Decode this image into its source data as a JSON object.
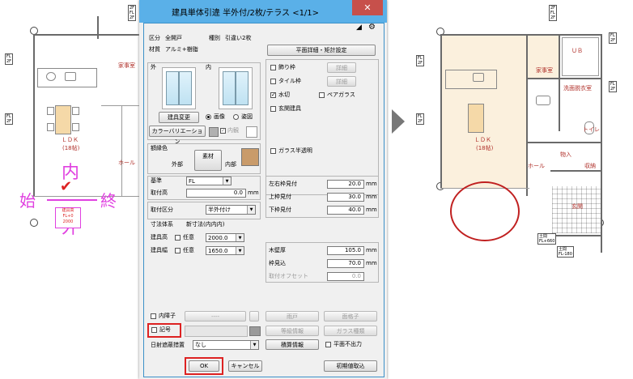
{
  "dialog": {
    "title": "建具単体引違 半外付/2枚/テラス <1/1>",
    "close": "✕",
    "kubun_label": "区分",
    "kubun_value": "全開戸",
    "shubetsu_label": "種別",
    "shubetsu_value": "引違い2枚",
    "zaishitsu_label": "材質",
    "zaishitsu_value": "アルミ+樹脂",
    "heimen_button": "平面詳細・矩計設定",
    "soto_label": "外",
    "uchi_label": "内",
    "tategu_henko": "建具変更",
    "radio_gazo": "画像",
    "radio_sugata": "姿図",
    "color_variation": "カラーバリエーション",
    "naikan": "内観",
    "gakuen_label": "額縁色",
    "sozai_button": "素材",
    "gaibu": "外部",
    "naibu": "内部",
    "kijun_label": "基準",
    "kijun_value": "FL",
    "toritsukedaka_label": "取付高",
    "toritsukedaka_value": "0.0",
    "unit_mm": "mm",
    "toritsuke_kubun_label": "取付区分",
    "toritsuke_kubun_value": "半外付け",
    "sunpo_label": "寸法体系",
    "sunpo_value": "新寸法(内内内)",
    "takasa_label": "建具高",
    "haba_label": "建具幅",
    "nini": "任意",
    "takasa_value": "2000.0",
    "haba_value": "1650.0",
    "right_checks": [
      "飾り枠",
      "タイル枠",
      "水切",
      "玄関建具"
    ],
    "shosai": "詳細",
    "pair_glass": "ペアガラス",
    "glass_semi": "ガラス半透明",
    "dims": [
      {
        "label": "左右枠見付",
        "value": "20.0"
      },
      {
        "label": "上枠見付",
        "value": "30.0"
      },
      {
        "label": "下枠見付",
        "value": "40.0"
      }
    ],
    "kabe_label": "木壁厚",
    "kabe_value": "105.0",
    "wakumi_label": "枠見込",
    "wakumi_value": "70.0",
    "offset_label": "取付オフセット",
    "offset_value": "0.0",
    "naishoji": "内障子",
    "naishoji_field": "----",
    "amado": "雨戸",
    "mengoshi": "面格子",
    "kigo": "記号",
    "kyu_joho": "等級情報",
    "glass_shurui": "ガラス種類",
    "hiyoke_label": "日射遮蔽措置",
    "hiyoke_value": "なし",
    "sekisan": "積算情報",
    "heimen_fushutsu": "平面不出力",
    "ok": "OK",
    "cancel": "キャンセル",
    "shoki": "初期値取込"
  },
  "left_plan": {
    "room_ldk": "ＬＤＫ",
    "room_ldk_size": "(18帖)",
    "room_kaji": "家事室",
    "hall": "ホール",
    "marker_in": "内",
    "marker_out": "外",
    "marker_start": "始",
    "marker_end": "終",
    "tag_lines": [
      "建具高",
      "FL+0",
      "2000"
    ]
  },
  "right_plan": {
    "room_ldk": "ＬＤＫ",
    "room_ldk_size": "(18帖)",
    "room_kaji": "家事室",
    "room_sen": "洗面脱衣室",
    "room_ub": "ＵＢ",
    "room_toilet": "トイレ",
    "room_monoire": "物入",
    "room_shuno": "収納",
    "room_genkan": "玄関",
    "hall": "ホール",
    "fl_tag_1": [
      "土間",
      "FL+660"
    ],
    "fl_tag_2": [
      "土間",
      "FL-180"
    ]
  },
  "colors": {
    "titlebar": "#5ab0e8",
    "close": "#c7504b",
    "highlight": "#d22222",
    "marker": "#e040e0"
  }
}
